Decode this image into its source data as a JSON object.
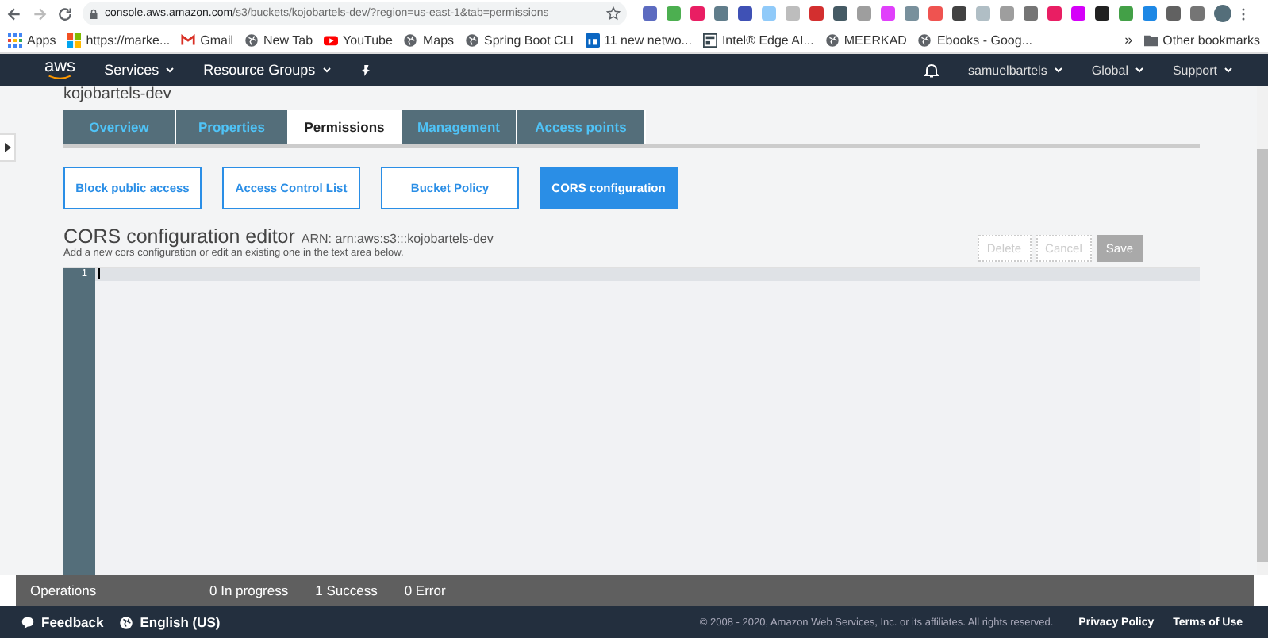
{
  "browser": {
    "url_host": "console.aws.amazon.com",
    "url_path": "/s3/buckets/kojobartels-dev/?region=us-east-1&tab=permissions",
    "bookmarks": [
      {
        "label": "Apps",
        "kind": "apps"
      },
      {
        "label": "https://marke...",
        "kind": "tiles"
      },
      {
        "label": "Gmail",
        "kind": "mail"
      },
      {
        "label": "New Tab",
        "kind": "globe"
      },
      {
        "label": "YouTube",
        "kind": "video"
      },
      {
        "label": "Maps",
        "kind": "globe"
      },
      {
        "label": "Spring Boot CLI",
        "kind": "globe"
      },
      {
        "label": "11 new netwo...",
        "kind": "square"
      },
      {
        "label": "Intel® Edge AI...",
        "kind": "page"
      },
      {
        "label": "MEERKAD",
        "kind": "globe"
      },
      {
        "label": "Ebooks - Goog...",
        "kind": "globe"
      }
    ],
    "more": "»",
    "other_bookmarks": "Other bookmarks"
  },
  "nav": {
    "logo": "aws",
    "menus": [
      "Services",
      "Resource Groups"
    ],
    "right_menus": [
      "samuelbartels",
      "Global",
      "Support"
    ]
  },
  "bucket_title": "kojobartels-dev",
  "tabs": [
    {
      "label": "Overview",
      "selected": false
    },
    {
      "label": "Properties",
      "selected": false
    },
    {
      "label": "Permissions",
      "selected": true
    },
    {
      "label": "Management",
      "selected": false
    },
    {
      "label": "Access points",
      "selected": false
    }
  ],
  "sections": [
    {
      "label": "Block public access",
      "selected": false
    },
    {
      "label": "Access Control List",
      "selected": false
    },
    {
      "label": "Bucket Policy",
      "selected": false
    },
    {
      "label": "CORS configuration",
      "selected": true
    }
  ],
  "editor": {
    "title": "CORS configuration editor",
    "arn": "ARN: arn:aws:s3:::kojobartels-dev",
    "hint": "Add a new cors configuration or edit an existing one in the text area below.",
    "buttons": [
      {
        "label": "Delete",
        "kind": "default",
        "disabled": true
      },
      {
        "label": "Cancel",
        "kind": "default",
        "disabled": true
      },
      {
        "label": "Save",
        "kind": "primary",
        "disabled": true
      }
    ],
    "line_numbers": [
      "1"
    ]
  },
  "operations": {
    "label": "Operations",
    "counts": [
      "0 In progress",
      "1 Success",
      "0 Error"
    ]
  },
  "footer": {
    "feedback": "Feedback",
    "language": "English (US)",
    "copyright": "© 2008 - 2020, Amazon Web Services, Inc. or its affiliates. All rights reserved.",
    "links": [
      "Privacy Policy",
      "Terms of Use"
    ]
  }
}
